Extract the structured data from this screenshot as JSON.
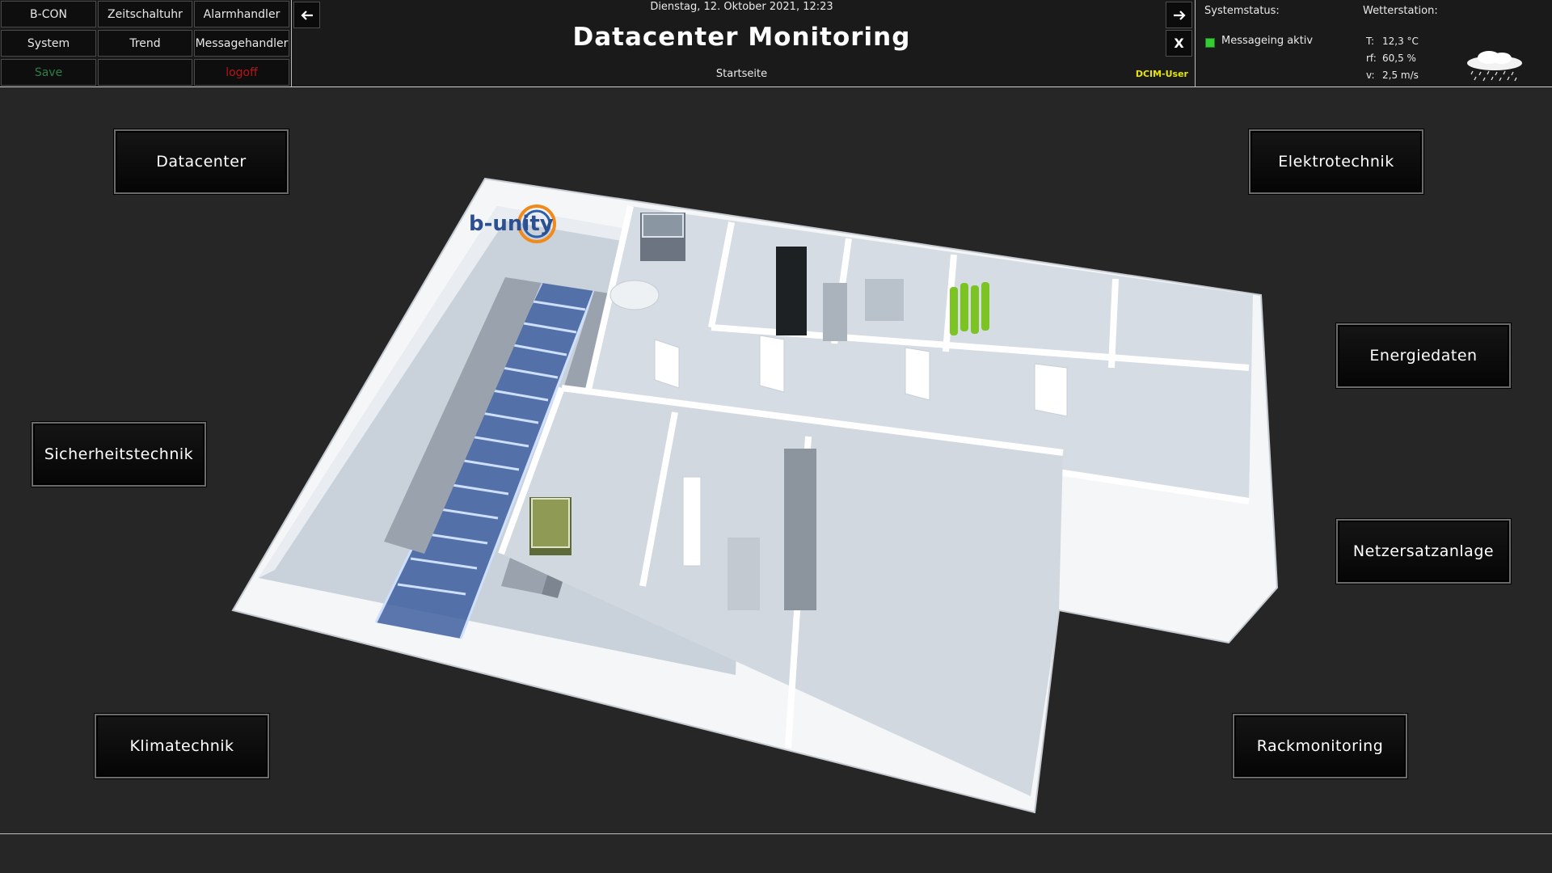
{
  "nav": {
    "row1": [
      "B-CON",
      "Zeitschaltuhr",
      "Alarmhandler"
    ],
    "row2": [
      "System",
      "Trend",
      "Messagehandler"
    ],
    "row3": [
      "Save",
      "",
      "logoff"
    ]
  },
  "header": {
    "datetime": "Dienstag, 12. Oktober 2021, 12:23",
    "title": "Datacenter Monitoring",
    "subtitle": "Startseite",
    "user": "DCIM-User",
    "back_icon": "arrow-left-icon",
    "forward_icon": "arrow-right-icon",
    "close_label": "X"
  },
  "status": {
    "label": "Systemstatus:",
    "item": "Messageing aktiv",
    "led_color": "#33cc33"
  },
  "weather": {
    "label": "Wetterstation:",
    "t_key": "T:",
    "t_val": "12,3 °C",
    "rf_key": "rf:",
    "rf_val": "60,5 %",
    "v_key": "v:",
    "v_val": "2,5 m/s",
    "icon": "rain-cloud-icon"
  },
  "floorplan": {
    "logo": "b-unity"
  },
  "buttons": {
    "datacenter": "Datacenter",
    "elektrotechnik": "Elektrotechnik",
    "energiedaten": "Energiedaten",
    "sicherheitstechnik": "Sicherheitstechnik",
    "netzersatzanlage": "Netzersatzanlage",
    "klimatechnik": "Klimatechnik",
    "rackmonitoring": "Rackmonitoring"
  }
}
